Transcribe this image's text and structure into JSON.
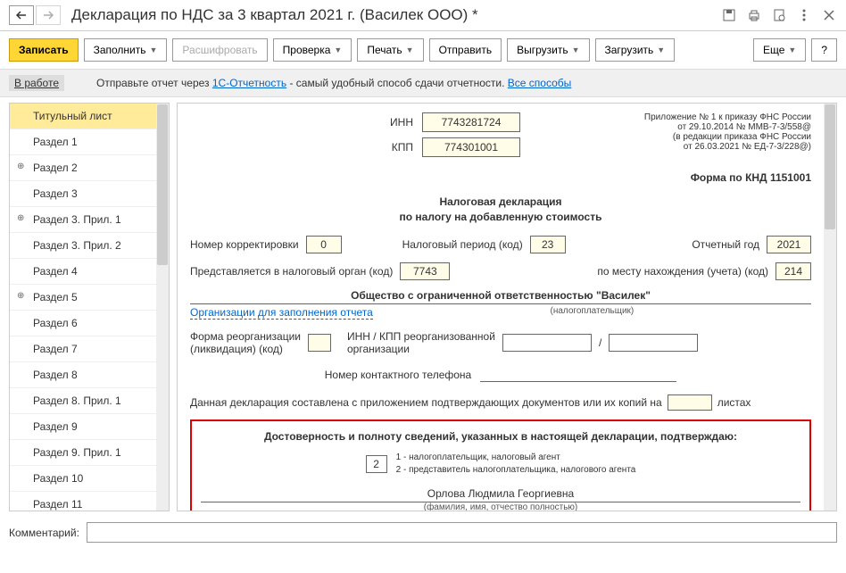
{
  "titlebar": {
    "title": "Декларация по НДС за 3 квартал 2021 г. (Василек ООО) *"
  },
  "toolbar": {
    "save": "Записать",
    "fill": "Заполнить",
    "decode": "Расшифровать",
    "check": "Проверка",
    "print": "Печать",
    "send": "Отправить",
    "unload": "Выгрузить",
    "upload": "Загрузить",
    "more": "Еще",
    "help": "?"
  },
  "infobar": {
    "status": "В работе",
    "txt1": "Отправьте отчет через ",
    "link1": "1С-Отчетность",
    "txt2": " - самый удобный способ сдачи отчетности. ",
    "link2": "Все способы"
  },
  "sidebar": {
    "items": [
      {
        "label": "Титульный лист",
        "active": true
      },
      {
        "label": "Раздел 1"
      },
      {
        "label": "Раздел 2",
        "exp": true
      },
      {
        "label": "Раздел 3"
      },
      {
        "label": "Раздел 3. Прил. 1",
        "exp": true
      },
      {
        "label": "Раздел 3. Прил. 2"
      },
      {
        "label": "Раздел 4"
      },
      {
        "label": "Раздел 5",
        "exp": true
      },
      {
        "label": "Раздел 6"
      },
      {
        "label": "Раздел 7"
      },
      {
        "label": "Раздел 8"
      },
      {
        "label": "Раздел 8. Прил. 1"
      },
      {
        "label": "Раздел 9"
      },
      {
        "label": "Раздел 9. Прил. 1"
      },
      {
        "label": "Раздел 10"
      },
      {
        "label": "Раздел 11"
      }
    ]
  },
  "content": {
    "inn_lbl": "ИНН",
    "inn": "7743281724",
    "kpp_lbl": "КПП",
    "kpp": "774301001",
    "appendix1": "Приложение № 1 к приказу ФНС России",
    "appendix2": "от 29.10.2014 № ММВ-7-3/558@",
    "appendix3": "(в редакции приказа ФНС России",
    "appendix4": "от 26.03.2021 № ЕД-7-3/228@)",
    "knd": "Форма по КНД 1151001",
    "decl1": "Налоговая декларация",
    "decl2": "по налогу на добавленную стоимость",
    "corr_lbl": "Номер корректировки",
    "corr": "0",
    "period_lbl": "Налоговый период (код)",
    "period": "23",
    "year_lbl": "Отчетный год",
    "year": "2021",
    "organ_lbl": "Представляется в налоговый орган (код)",
    "organ": "7743",
    "place_lbl": "по месту нахождения (учета) (код)",
    "place": "214",
    "orgname": "Общество с ограниченной ответственностью \"Василек\"",
    "orglink": "Организации для заполнения отчета",
    "orgsub": "(налогоплательщик)",
    "reorg_lbl1": "Форма реорганизации",
    "reorg_lbl2": "(ликвидация) (код)",
    "reorg_inn_lbl1": "ИНН / КПП реорганизованной",
    "reorg_inn_lbl2": "организации",
    "phone_lbl": "Номер контактного телефона",
    "doc_txt": "Данная декларация составлена с приложением подтверждающих документов или их копий на",
    "doc_sheets": "листах",
    "conf_hdr": "Достоверность и полноту сведений, указанных в настоящей декларации, подтверждаю:",
    "conf_code": "2",
    "conf_d1": "1 - налогоплательщик, налоговый агент",
    "conf_d2": "2 - представитель налогоплательщика, налогового агента",
    "fio": "Орлова Людмила Георгиевна",
    "fio_sub": "(фамилия, имя, отчество полностью)"
  },
  "footer": {
    "label": "Комментарий:"
  }
}
